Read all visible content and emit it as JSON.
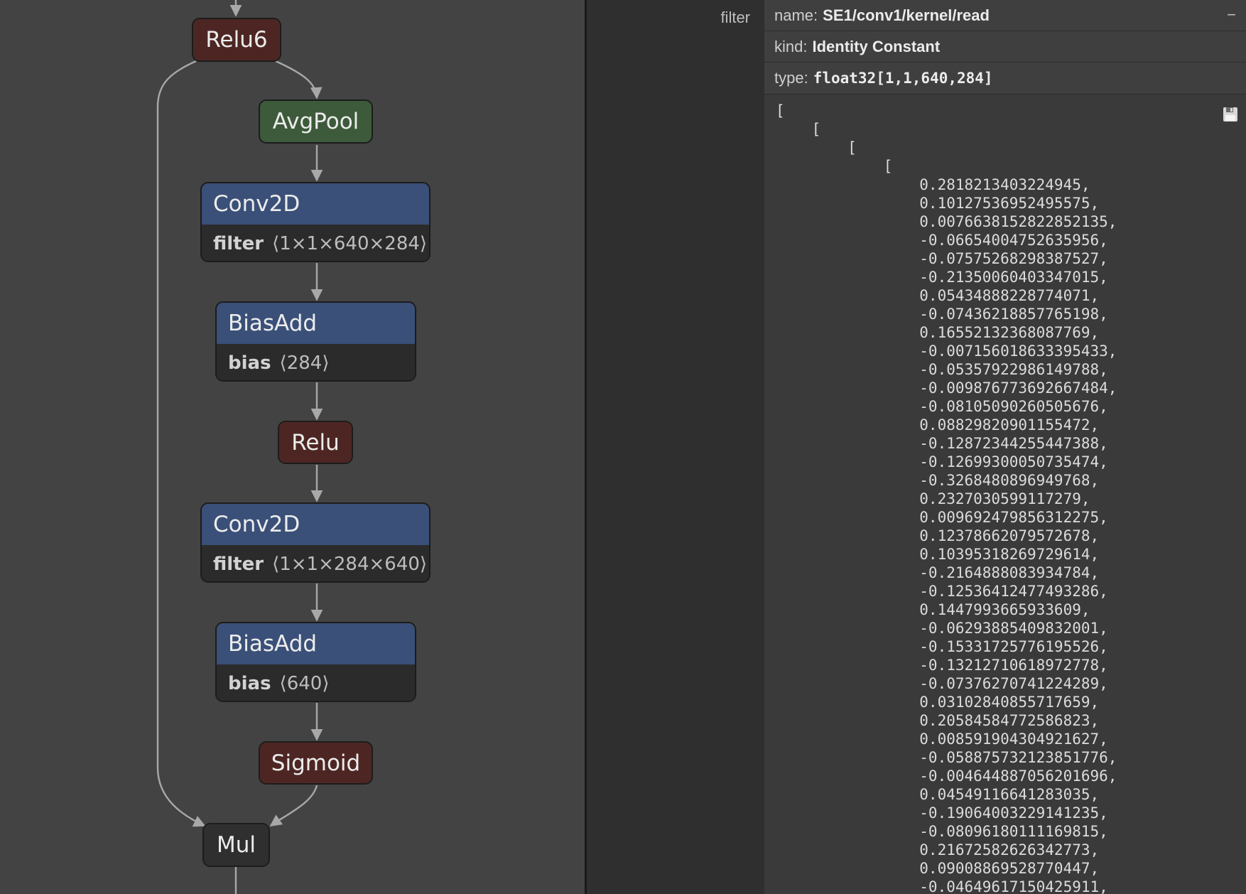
{
  "graph": {
    "nodes": {
      "relu6": {
        "op": "Relu6"
      },
      "avgpool": {
        "op": "AvgPool"
      },
      "conv1": {
        "op": "Conv2D",
        "attr_name": "filter",
        "attr_value": "⟨1×1×640×284⟩"
      },
      "bias1": {
        "op": "BiasAdd",
        "attr_name": "bias",
        "attr_value": "⟨284⟩"
      },
      "relu": {
        "op": "Relu"
      },
      "conv2": {
        "op": "Conv2D",
        "attr_name": "filter",
        "attr_value": "⟨1×1×284×640⟩"
      },
      "bias2": {
        "op": "BiasAdd",
        "attr_name": "bias",
        "attr_value": "⟨640⟩"
      },
      "sigmoid": {
        "op": "Sigmoid"
      },
      "mul": {
        "op": "Mul"
      }
    }
  },
  "sidebar": {
    "section_label": "filter",
    "name_key": "name:",
    "name_value": "SE1/conv1/kernel/read",
    "collapse_icon": "−",
    "kind_key": "kind:",
    "kind_value": "Identity Constant",
    "type_key": "type:",
    "type_value": "float32[1,1,640,284]",
    "save_icon": "save-icon",
    "tensor_open": [
      "[",
      "    [",
      "        [",
      "            ["
    ],
    "tensor_values": [
      "0.2818213403224945,",
      "0.10127536952495575,",
      "0.007663815282285213​5,",
      "-0.06654004752635956,",
      "-0.07575268298387527,",
      "-0.21350060403347015,",
      "0.05434888228774071,",
      "-0.07436218857765198,",
      "0.16552132368087769,",
      "-0.007156018633395433,",
      "-0.05357922986149788,",
      "-0.009876773692667484,",
      "-0.08105090260505676,",
      "0.08829820901155472,",
      "-0.12872344255447388,",
      "-0.12699300050735474,",
      "-0.3268480896949768,",
      "0.2327030599117279,",
      "0.009692479856312275,",
      "0.12378662079572678,",
      "0.10395318269729614,",
      "-0.2164888083934784,",
      "-0.12536412477493286,",
      "0.1447993665933609,",
      "-0.06293885409832001,",
      "-0.15331725776195526,",
      "-0.13212710618972778,",
      "-0.07376270741224289,",
      "0.03102840855717659,",
      "0.20584584772586823,",
      "0.008591904304921627,",
      "-0.058875732123851776,",
      "-0.004644887056201696,",
      "0.04549116641283035,",
      "-0.19064003229141235,",
      "-0.08096180111169815,",
      "0.21672582626342773,",
      "0.09008869528770447,",
      "-0.04649617150425911,"
    ]
  }
}
